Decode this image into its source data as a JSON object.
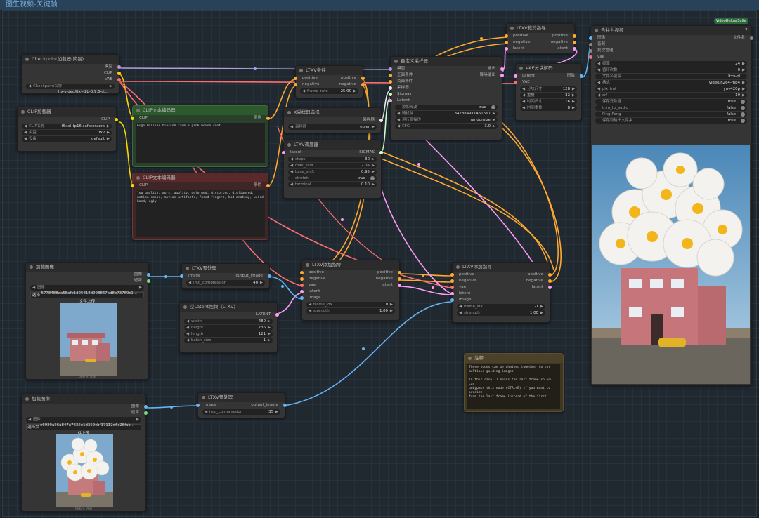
{
  "workflow_title": "图生视频-关键帧",
  "colors": {
    "model": "#b39ddb",
    "clip": "#ffd500",
    "vae": "#ff6e6e",
    "cond": "#ffa931",
    "latent": "#ff9cf9",
    "image": "#64b5f6",
    "sampler": "#ececec",
    "sigmas": "#cdffcd"
  },
  "nodes": {
    "checkpoint": {
      "title": "Checkpoint加载器(简易)",
      "out1": "模型",
      "out2": "CLIP",
      "out3": "VAE",
      "w_label": "Checkpoint名称",
      "w_value": "ltx-video/ltxv-2b-0.9.6-d..."
    },
    "cliploader": {
      "title": "CLIP加载器",
      "out": "CLIP",
      "w1_label": "CLIP名称",
      "w1_value": "t5xxl_fp16.safetensors",
      "w2_label": "类型",
      "w2_value": "ltxv",
      "w3_label": "设备",
      "w3_value": "default"
    },
    "clip_pos": {
      "title": "CLIP文本编码器",
      "in": "CLIP",
      "out": "条件",
      "text": "huge Daisies blossom from a pink house roof"
    },
    "clip_neg": {
      "title": "CLIP文本编码器",
      "in": "CLIP",
      "out": "条件",
      "text": "low quality, worst quality, deformed, distorted, disfigured, motion smear, motion artifacts, fused fingers, bad anatomy, weird hand, ugly"
    },
    "ltxv_cond": {
      "title": "LTXV条件",
      "in1": "positive",
      "in2": "negative",
      "out1": "positive",
      "out2": "negative",
      "w_label": "frame_rate",
      "w_value": "25.00"
    },
    "ksampler_select": {
      "title": "K采样器选择",
      "out": "采样器",
      "w_label": "采样器",
      "w_value": "euler"
    },
    "ltxv_scheduler": {
      "title": "LTXV调度器",
      "in": "latent",
      "out": "SIGMAS",
      "w1_label": "steps",
      "w1_value": "30",
      "w2_label": "max_shift",
      "w2_value": "2.05",
      "w3_label": "base_shift",
      "w3_value": "0.95",
      "w4_label": "stretch",
      "w4_value": "true",
      "w5_label": "terminal",
      "w5_value": "0.10"
    },
    "custom_sampler": {
      "title": "自定义采样器",
      "in1": "模型",
      "in2": "正面条件",
      "in3": "负面条件",
      "in4": "采样器",
      "in5": "Sigmas",
      "in6": "Latent",
      "out1": "输出",
      "out2": "降噪输出",
      "w1_label": "添加噪波",
      "w1_value": "true",
      "w2_label": "随机种",
      "w2_value": "842884971451667",
      "w3_label": "运行后操作",
      "w3_value": "randomize",
      "w4_label": "CFG",
      "w4_value": "3.0"
    },
    "ltxv_crop": {
      "title": "LTXV裁剪指导",
      "in1": "positive",
      "in2": "negative",
      "in3": "latent",
      "out1": "positive",
      "out2": "negative",
      "out3": "latent"
    },
    "vae_decode": {
      "title": "VAE分块解码",
      "in1": "Latent",
      "in2": "VAE",
      "out": "图像",
      "w1_label": "分块尺寸",
      "w1_value": "128",
      "w2_label": "重叠",
      "w2_value": "32",
      "w3_label": "时间尺寸",
      "w3_value": "16",
      "w4_label": "时间重叠",
      "w4_value": "8"
    },
    "combine": {
      "title": "合并为视频",
      "badge": "VideoHelperSuite",
      "help": "?",
      "in1": "图像",
      "in2": "音频",
      "in3": "批次管理",
      "in4": "vae",
      "out": "文件名",
      "w1_label": "帧率",
      "w1_value": "24",
      "w2_label": "循环次数",
      "w2_value": "0",
      "w3_label": "文件名前缀",
      "w3_value": "ltxv-pl",
      "w4_label": "格式",
      "w4_value": "video/h264-mp4",
      "w5_label": "pix_fmt",
      "w5_value": "yuv420p",
      "w6_label": "crf",
      "w6_value": "19",
      "w7_label": "保存元数据",
      "w7_value": "true",
      "w8_label": "trim_to_audio",
      "w8_value": "false",
      "w9_label": "Ping-Pong",
      "w9_value": "false",
      "w10_label": "保存到输出文件夹",
      "w10_value": "true"
    },
    "load_image1": {
      "title": "加载图像",
      "out1": "图像",
      "out2": "遮罩",
      "w_label": "图像",
      "w_value": "5778488aa58afb1d25818d998867ad8b73769c1...",
      "btn": "选择文件上传",
      "size": "686 × 768"
    },
    "ltxv_pre1": {
      "title": "LTXV预处理",
      "in": "image",
      "out": "output_image",
      "w_label": "img_compression",
      "w_value": "40"
    },
    "empty_latent": {
      "title": "空Latent视频（LTXV）",
      "out": "LATENT",
      "w1_label": "width",
      "w1_value": "480",
      "w2_label": "height",
      "w2_value": "736",
      "w3_label": "length",
      "w3_value": "121",
      "w4_label": "batch_size",
      "w4_value": "1"
    },
    "guide1": {
      "title": "LTXV添加指导",
      "in1": "positive",
      "in2": "negative",
      "in3": "vae",
      "in4": "latent",
      "in5": "image",
      "out1": "positive",
      "out2": "negative",
      "out3": "latent",
      "w1_label": "frame_idx",
      "w1_value": "0",
      "w2_label": "strength",
      "w2_value": "1.00"
    },
    "guide2": {
      "title": "LTXV添加指导",
      "in1": "positive",
      "in2": "negative",
      "in3": "vae",
      "in4": "latent",
      "in5": "image",
      "out1": "positive",
      "out2": "negative",
      "out3": "latent",
      "w1_label": "frame_idx",
      "w1_value": "-1",
      "w2_label": "strength",
      "w2_value": "1.00"
    },
    "note": {
      "title": "注释",
      "text": "These nodes can be chained together to set multiple guiding images\n\nIn this case -1 means the last frame so you can\nunbypass this node (CTRL+B) if you want to predict\nfrom the last frame instead of the first."
    },
    "load_image2": {
      "title": "加载图像",
      "out1": "图像",
      "out2": "遮罩",
      "w_label": "图像",
      "w_value": "e6929a36a847a7635e1d359cbf17112e6c28fab...",
      "btn": "选择文件上传",
      "size": "686 × 768"
    },
    "ltxv_pre2": {
      "title": "LTXV预处理",
      "in": "image",
      "out": "output_image",
      "w_label": "img_compression",
      "w_value": "35"
    }
  }
}
